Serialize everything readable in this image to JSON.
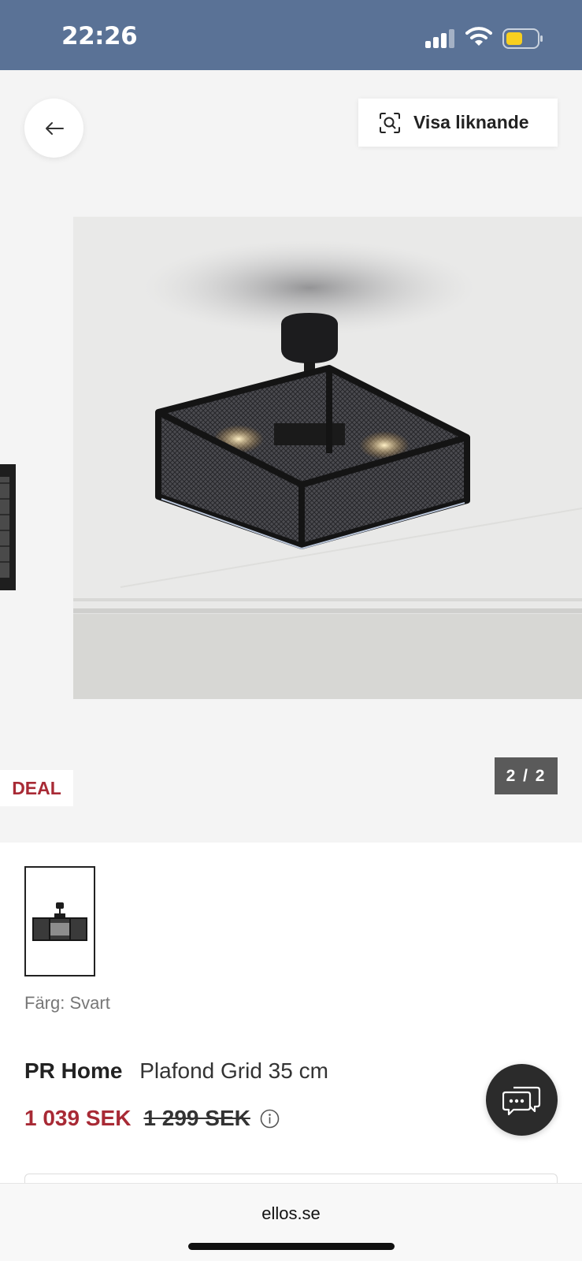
{
  "status_bar": {
    "time": "22:26",
    "signal_icon": "cellular-signal-icon",
    "wifi_icon": "wifi-icon",
    "battery_icon": "battery-icon",
    "battery_color": "#f7cf1f",
    "background": "#5a7296"
  },
  "hero": {
    "back_icon": "arrow-left-icon",
    "similar_button": {
      "icon": "visual-search-icon",
      "label": "Visa liknande"
    },
    "deal_badge": "DEAL",
    "pager": "2 / 2"
  },
  "product": {
    "color_label": "Färg: Svart",
    "brand": "PR Home",
    "name": "Plafond Grid 35 cm",
    "price_current": "1 039 SEK",
    "price_original": "1 299 SEK",
    "price_color": "#a82a35",
    "info_icon": "info-icon"
  },
  "chat": {
    "icon": "chat-bubbles-icon"
  },
  "browser": {
    "url": "ellos.se"
  }
}
